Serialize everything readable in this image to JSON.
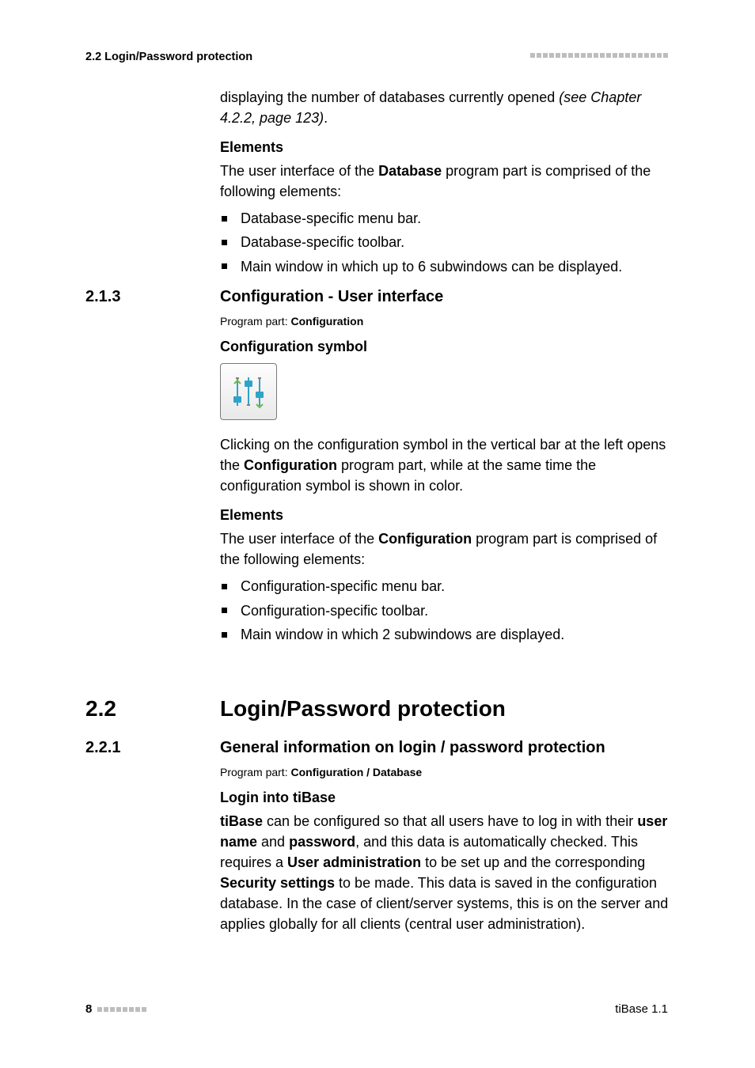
{
  "header": {
    "left": "2.2 Login/Password protection"
  },
  "intro": {
    "line1": "displaying the number of databases currently opened ",
    "ref": "(see Chapter 4.2.2, page 123)",
    "tail": "."
  },
  "db": {
    "elements_heading": "Elements",
    "elements_intro_a": "The user interface of the ",
    "elements_intro_bold": "Database",
    "elements_intro_b": " program part is comprised of the following elements:",
    "items": [
      "Database-specific menu bar.",
      "Database-specific toolbar.",
      "Main window in which up to 6 subwindows can be displayed."
    ]
  },
  "s213": {
    "num": "2.1.3",
    "title": "Configuration - User interface",
    "note_a": "Program part: ",
    "note_b": "Configuration",
    "symbol_heading": "Configuration symbol",
    "para_a": "Clicking on the configuration symbol in the vertical bar at the left opens the ",
    "para_bold": "Configuration",
    "para_b": " program part, while at the same time the configuration symbol is shown in color.",
    "elements_heading": "Elements",
    "elements_intro_a": "The user interface of the ",
    "elements_intro_bold": "Configuration",
    "elements_intro_b": " program part is comprised of the following elements:",
    "items": [
      "Configuration-specific menu bar.",
      "Configuration-specific toolbar.",
      "Main window in which 2 subwindows are displayed."
    ]
  },
  "s22": {
    "num": "2.2",
    "title": "Login/Password protection"
  },
  "s221": {
    "num": "2.2.1",
    "title": "General information on login / password protection",
    "note_a": "Program part: ",
    "note_b": "Configuration / Database",
    "login_heading": "Login into tiBase",
    "p": {
      "t0_b": "tiBase",
      "t1": " can be configured so that all users have to log in with their ",
      "t2_b": "user name",
      "t3": " and ",
      "t4_b": "password",
      "t5": ", and this data is automatically checked. This requires a ",
      "t6_b": "User administration",
      "t7": " to be set up and the corresponding ",
      "t8_b": "Security settings",
      "t9": " to be made. This data is saved in the configuration database. In the case of client/server systems, this is on the server and applies globally for all clients (central user administration)."
    }
  },
  "footer": {
    "page": "8",
    "product": "tiBase 1.1"
  }
}
